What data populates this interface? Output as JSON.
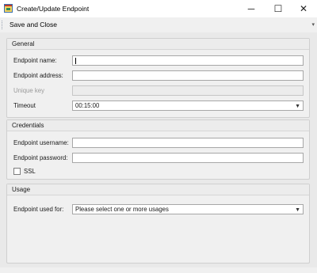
{
  "window": {
    "title": "Create/Update Endpoint",
    "minimize_glyph": "─",
    "maximize_glyph": "☐",
    "close_glyph": "✕",
    "icon": "app-window-icon"
  },
  "toolbar": {
    "save_close_label": "Save and Close",
    "overflow_glyph": "▾"
  },
  "general": {
    "header": "General",
    "endpoint_name_label": "Endpoint name:",
    "endpoint_name_value": "",
    "endpoint_address_label": "Endpoint address:",
    "endpoint_address_value": "",
    "unique_key_label": "Unique key",
    "unique_key_value": "",
    "timeout_label": "Timeout",
    "timeout_value": "00:15:00",
    "combo_glyph": "▼"
  },
  "credentials": {
    "header": "Credentials",
    "username_label": "Endpoint username:",
    "username_value": "",
    "password_label": "Endpoint password:",
    "password_value": "",
    "ssl_label": "SSL",
    "ssl_checked": false
  },
  "usage": {
    "header": "Usage",
    "used_for_label": "Endpoint used for:",
    "used_for_value": "Please select one or more usages",
    "combo_glyph": "▼"
  },
  "colors": {
    "window_bg": "#f0f0f0",
    "titlebar_bg": "#ffffff",
    "input_border": "#a7a7a7"
  }
}
